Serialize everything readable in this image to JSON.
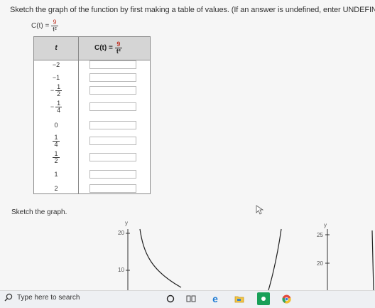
{
  "instruction": "Sketch the graph of the function by first making a table of values. (If an answer is undefined, enter UNDEFINED.)",
  "function": {
    "lhs": "C(t) =",
    "numerator": "9",
    "denominator": "t²"
  },
  "table": {
    "col_t": "t",
    "col_c": {
      "lhs": "C(t) =",
      "numerator": "9",
      "denominator": "t²"
    },
    "rows": [
      {
        "label": "−2"
      },
      {
        "label": "−1"
      },
      {
        "sign": "−",
        "num": "1",
        "den": "2"
      },
      {
        "sign": "−",
        "num": "1",
        "den": "4"
      },
      {
        "label": "0"
      },
      {
        "sign": "",
        "num": "1",
        "den": "4"
      },
      {
        "sign": "",
        "num": "1",
        "den": "2"
      },
      {
        "label": "1"
      },
      {
        "label": "2"
      }
    ]
  },
  "sketch_label": "Sketch the graph.",
  "graph_left": {
    "axis_label": "y",
    "ticks": [
      "20",
      "10"
    ]
  },
  "graph_right": {
    "axis_label": "y",
    "ticks": [
      "25",
      "20"
    ]
  },
  "taskbar": {
    "search_placeholder": "Type here to search"
  }
}
